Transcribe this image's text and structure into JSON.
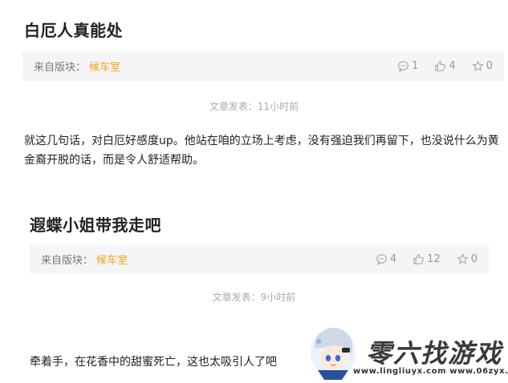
{
  "posts": [
    {
      "title": "白厄人真能处",
      "source_label": "来自版块：",
      "source_value": "候车室",
      "comments": "1",
      "likes": "4",
      "favorites": "0",
      "time": "文章发表：11小时前",
      "body": "就这几句话，对白厄好感度up。他站在咱的立场上考虑，没有强迫我们再留下，也没说什么为黄金裔开脱的话，而是令人舒适帮助。"
    },
    {
      "title": "遐蝶小姐带我走吧",
      "source_label": "来自版块：",
      "source_value": "候车室",
      "comments": "4",
      "likes": "12",
      "favorites": "0",
      "time": "文章发表：9小时前",
      "body": "牵着手，在花香中的甜蜜死亡，这也太吸引人了吧"
    }
  ],
  "watermark": {
    "brand": "零六找游戏",
    "url": "www.lingliuyx.com  www.06zyx.com"
  },
  "colors": {
    "accent": "#f5a31a",
    "meta_bg": "#f5f5f7",
    "muted": "#999999"
  }
}
